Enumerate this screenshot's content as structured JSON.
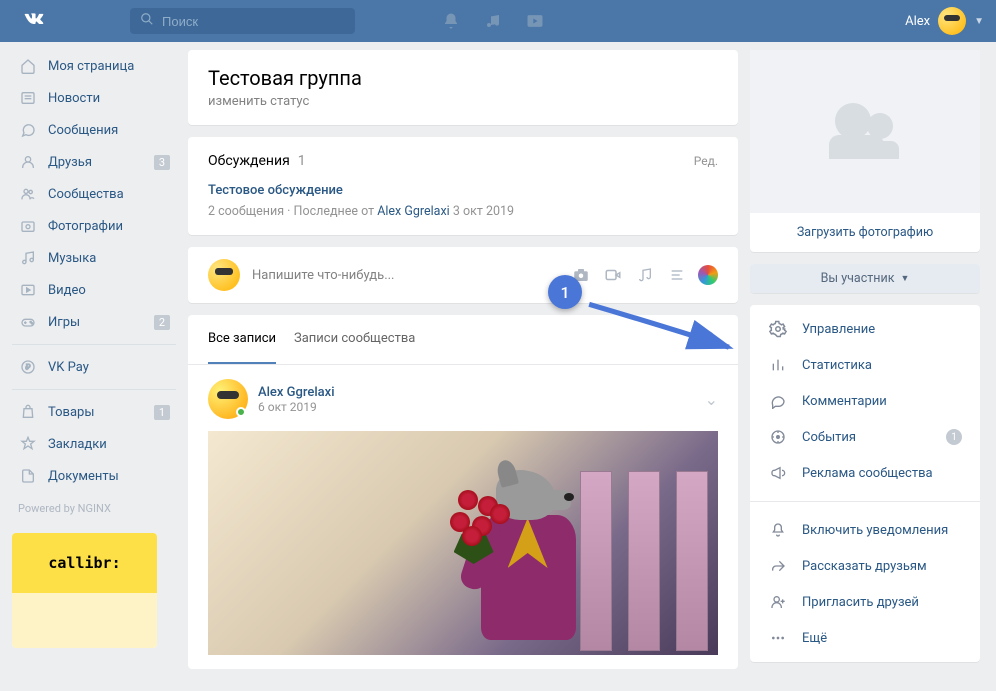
{
  "header": {
    "search_placeholder": "Поиск",
    "username": "Alex"
  },
  "sidebar": {
    "items": [
      {
        "label": "Моя страница",
        "icon": "home",
        "badge": ""
      },
      {
        "label": "Новости",
        "icon": "news",
        "badge": ""
      },
      {
        "label": "Сообщения",
        "icon": "msg",
        "badge": ""
      },
      {
        "label": "Друзья",
        "icon": "friends",
        "badge": "3"
      },
      {
        "label": "Сообщества",
        "icon": "groups",
        "badge": ""
      },
      {
        "label": "Фотографии",
        "icon": "photos",
        "badge": ""
      },
      {
        "label": "Музыка",
        "icon": "music",
        "badge": ""
      },
      {
        "label": "Видео",
        "icon": "video",
        "badge": ""
      },
      {
        "label": "Игры",
        "icon": "games",
        "badge": "2"
      }
    ],
    "items2": [
      {
        "label": "VK Pay",
        "icon": "pay",
        "badge": ""
      }
    ],
    "items3": [
      {
        "label": "Товары",
        "icon": "market",
        "badge": "1"
      },
      {
        "label": "Закладки",
        "icon": "bookmark",
        "badge": ""
      },
      {
        "label": "Документы",
        "icon": "docs",
        "badge": ""
      }
    ],
    "powered": "Powered by NGINX",
    "ad_text": "callibr:"
  },
  "group": {
    "title": "Тестовая группа",
    "status_placeholder": "изменить статус"
  },
  "discussions": {
    "title": "Обсуждения",
    "count": "1",
    "edit": "Ред.",
    "topic": "Тестовое обсуждение",
    "meta_msgs": "2 сообщения",
    "meta_sep": "  ·  Последнее от ",
    "meta_author": "Alex Ggrelaxi",
    "meta_date": " 3 окт 2019"
  },
  "composer": {
    "placeholder": "Напишите что-нибудь..."
  },
  "tabs": {
    "all": "Все записи",
    "community": "Записи сообщества"
  },
  "post": {
    "author": "Alex Ggrelaxi",
    "date": "6 окт 2019"
  },
  "aside": {
    "upload": "Загрузить фотографию",
    "member": "Вы участник",
    "menu1": [
      {
        "label": "Управление",
        "icon": "gear",
        "badge": ""
      },
      {
        "label": "Статистика",
        "icon": "stats",
        "badge": ""
      },
      {
        "label": "Комментарии",
        "icon": "comment",
        "badge": ""
      },
      {
        "label": "События",
        "icon": "event",
        "badge": "1"
      },
      {
        "label": "Реклама сообщества",
        "icon": "ad",
        "badge": ""
      }
    ],
    "menu2": [
      {
        "label": "Включить уведомления",
        "icon": "bell"
      },
      {
        "label": "Рассказать друзьям",
        "icon": "share"
      },
      {
        "label": "Пригласить друзей",
        "icon": "invite"
      },
      {
        "label": "Ещё",
        "icon": "more"
      }
    ]
  },
  "annotation": {
    "num": "1"
  }
}
